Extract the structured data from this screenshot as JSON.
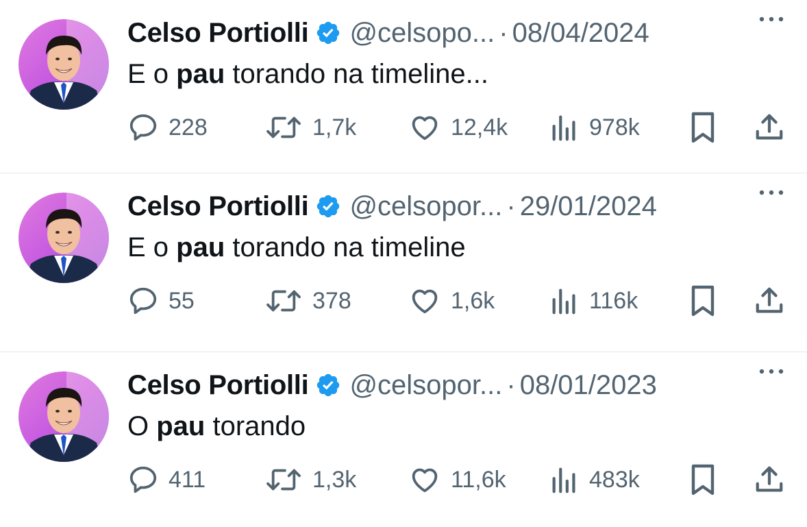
{
  "colors": {
    "text": "#0f1419",
    "secondary": "#536471",
    "verified": "#1d9bf0",
    "divider": "#e4e7ea"
  },
  "icons": {
    "reply": "speech-bubble-icon",
    "retweet": "retweet-icon",
    "like": "heart-icon",
    "views": "bar-chart-icon",
    "bookmark": "bookmark-icon",
    "share": "share-upload-icon",
    "more": "three-dots-icon",
    "verified": "verified-badge-icon"
  },
  "tweets": [
    {
      "name": "Celso Portiolli",
      "handle": "@celsopo...",
      "separator": "·",
      "date": "08/04/2024",
      "text_before": "E o ",
      "text_bold": "pau",
      "text_after": " torando na timeline...",
      "replies": "228",
      "retweets": "1,7k",
      "likes": "12,4k",
      "views": "978k"
    },
    {
      "name": "Celso Portiolli",
      "handle": "@celsopor...",
      "separator": "·",
      "date": "29/01/2024",
      "text_before": "E o ",
      "text_bold": "pau",
      "text_after": " torando na timeline",
      "replies": "55",
      "retweets": "378",
      "likes": "1,6k",
      "views": "116k"
    },
    {
      "name": "Celso Portiolli",
      "handle": "@celsopor...",
      "separator": "·",
      "date": "08/01/2023",
      "text_before": "O ",
      "text_bold": "pau",
      "text_after": " torando",
      "replies": "411",
      "retweets": "1,3k",
      "likes": "11,6k",
      "views": "483k"
    }
  ]
}
